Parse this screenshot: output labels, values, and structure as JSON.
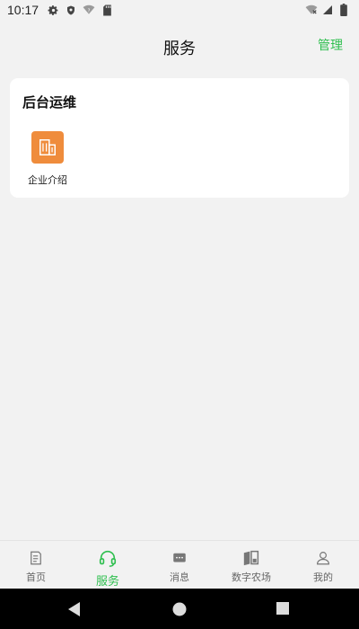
{
  "status_bar": {
    "time": "10:17",
    "left_icons": [
      "gear-icon",
      "shield-icon",
      "wifi-icon",
      "sd-card-icon"
    ],
    "right_icons": [
      "wifi-x-icon",
      "signal-icon",
      "battery-icon"
    ]
  },
  "header": {
    "title": "服务",
    "manage_label": "管理"
  },
  "section": {
    "title": "后台运维",
    "items": [
      {
        "label": "企业介绍",
        "icon": "building-icon",
        "icon_color": "#ef8c3c"
      }
    ]
  },
  "bottom_nav": {
    "items": [
      {
        "label": "首页",
        "icon": "home-document-icon",
        "active": false
      },
      {
        "label": "服务",
        "icon": "headset-icon",
        "active": true
      },
      {
        "label": "消息",
        "icon": "message-icon",
        "active": false
      },
      {
        "label": "数字农场",
        "icon": "farm-book-icon",
        "active": false
      },
      {
        "label": "我的",
        "icon": "user-icon",
        "active": false
      }
    ],
    "active_color": "#2fbf4f"
  },
  "system_nav": [
    "back-icon",
    "home-icon",
    "recents-icon"
  ]
}
